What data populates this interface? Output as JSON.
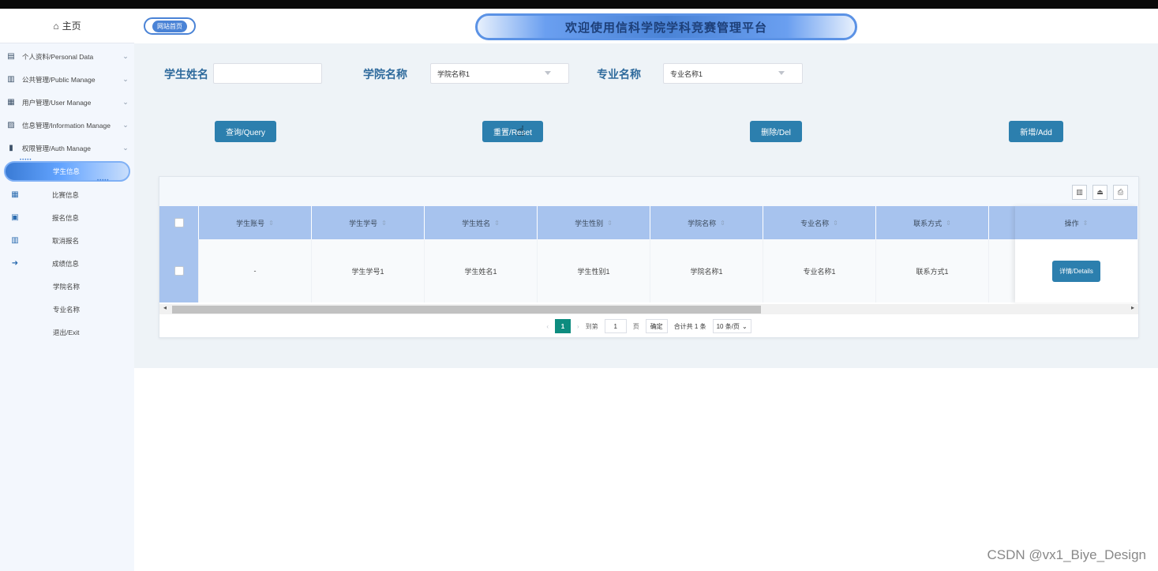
{
  "header": {
    "home_link": "网站首页",
    "title": "欢迎使用信科学院学科竞赛管理平台"
  },
  "sidebar": {
    "home": "主页",
    "groups": [
      {
        "label": "个人资料/Personal Data",
        "icon": "document-icon"
      },
      {
        "label": "公共管理/Public Manage",
        "icon": "clipboard-icon"
      },
      {
        "label": "用户管理/User Manage",
        "icon": "users-icon"
      },
      {
        "label": "信息管理/Information Manage",
        "icon": "chart-icon"
      },
      {
        "label": "权限管理/Auth Manage",
        "icon": "bookmark-icon"
      }
    ],
    "active": "学生信息",
    "items": [
      {
        "label": "比赛信息",
        "icon": "calendar-icon"
      },
      {
        "label": "报名信息",
        "icon": "calendar-check-icon"
      },
      {
        "label": "取消报名",
        "icon": "book-icon"
      },
      {
        "label": "成绩信息",
        "icon": "logout-arrow-icon"
      },
      {
        "label": "学院名称"
      },
      {
        "label": "专业名称"
      },
      {
        "label": "退出/Exit"
      }
    ]
  },
  "filters": {
    "student_name_label": "学生姓名",
    "student_name_value": "",
    "college_label": "学院名称",
    "college_value": "学院名称1",
    "major_label": "专业名称",
    "major_value": "专业名称1"
  },
  "actions": {
    "query": "查询/Query",
    "reset": "重置/Reset",
    "delete": "删除/Del",
    "add": "新增/Add"
  },
  "table": {
    "columns": [
      "学生账号",
      "学生学号",
      "学生姓名",
      "学生性别",
      "学院名称",
      "专业名称",
      "联系方式"
    ],
    "op_column": "操作",
    "rows": [
      {
        "cells": [
          "-",
          "学生学号1",
          "学生姓名1",
          "学生性别1",
          "学院名称1",
          "专业名称1",
          "联系方式1"
        ],
        "detail": "详情/Details"
      }
    ]
  },
  "pagination": {
    "current": "1",
    "goto_label": "到第",
    "goto_value": "1",
    "page_unit": "页",
    "confirm": "确定",
    "total": "合计共 1 条",
    "page_size": "10 条/页"
  },
  "watermark": "CSDN @vx1_Biye_Design"
}
